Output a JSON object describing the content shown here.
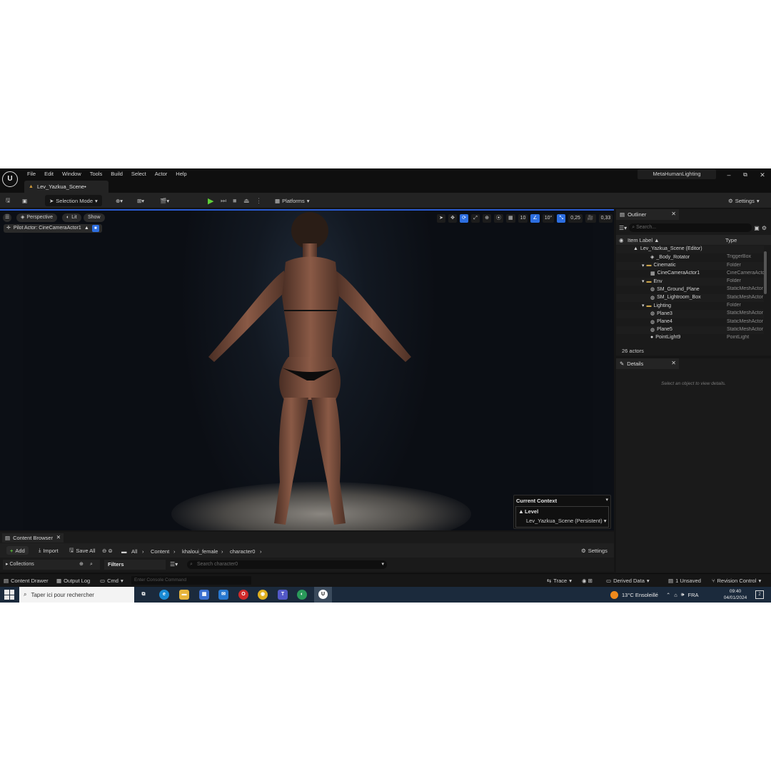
{
  "window": {
    "logo": "U",
    "menus": [
      "File",
      "Edit",
      "Window",
      "Tools",
      "Build",
      "Select",
      "Actor",
      "Help"
    ],
    "tab_title": "Lev_Yazkua_Scene•",
    "project_name": "MetaHumanLighting",
    "controls": [
      "–",
      "⧉",
      "✕"
    ]
  },
  "toolbar": {
    "selection_mode": "Selection Mode",
    "platforms": "Platforms",
    "settings": "Settings"
  },
  "viewport": {
    "perspective": "Perspective",
    "lit": "Lit",
    "show": "Show",
    "pilot_actor": "Pilot Actor: CineCameraActor1",
    "grid_size": "10",
    "rotation_snap": "10°",
    "scale_snap": "0,25",
    "camera_speed": "0,33"
  },
  "context": {
    "title": "Current Context",
    "level_label": "Level",
    "level_value": "Lev_Yazkua_Scene (Persistent)"
  },
  "outliner": {
    "tab": "Outliner",
    "search_placeholder": "Search...",
    "col_label": "Item Label ▲",
    "col_type": "Type",
    "rows": [
      {
        "label": "Lev_Yazkua_Scene (Editor)",
        "type": "",
        "indent": 0,
        "icon": "level"
      },
      {
        "label": "_Body_Rotator",
        "type": "TriggerBox",
        "indent": 2,
        "icon": "actor"
      },
      {
        "label": "Cinematic",
        "type": "Folder",
        "indent": 1,
        "icon": "folder"
      },
      {
        "label": "CineCameraActor1",
        "type": "CineCameraActor",
        "indent": 2,
        "icon": "camera"
      },
      {
        "label": "Env",
        "type": "Folder",
        "indent": 1,
        "icon": "folder"
      },
      {
        "label": "SM_Ground_Plane",
        "type": "StaticMeshActor",
        "indent": 2,
        "icon": "mesh"
      },
      {
        "label": "SM_Lightroom_Box",
        "type": "StaticMeshActor",
        "indent": 2,
        "icon": "mesh"
      },
      {
        "label": "Lighting",
        "type": "Folder",
        "indent": 1,
        "icon": "folder"
      },
      {
        "label": "Plane3",
        "type": "StaticMeshActor",
        "indent": 2,
        "icon": "mesh"
      },
      {
        "label": "Plane4",
        "type": "StaticMeshActor",
        "indent": 2,
        "icon": "mesh"
      },
      {
        "label": "Plane5",
        "type": "StaticMeshActor",
        "indent": 2,
        "icon": "mesh"
      },
      {
        "label": "PointLight9",
        "type": "PointLight",
        "indent": 2,
        "icon": "light"
      }
    ],
    "count": "26 actors"
  },
  "details": {
    "tab": "Details",
    "empty": "Select an object to view details."
  },
  "content_browser": {
    "tab": "Content Browser",
    "add": "Add",
    "import": "Import",
    "save_all": "Save All",
    "breadcrumbs": [
      "All",
      "Content",
      "khaloui_female",
      "character0"
    ],
    "settings": "Settings",
    "collections": "Collections",
    "filters": "Filters",
    "search_placeholder": "Search character0"
  },
  "statusbar": {
    "content_drawer": "Content Drawer",
    "output_log": "Output Log",
    "cmd": "Cmd",
    "console_placeholder": "Enter Console Command",
    "trace": "Trace",
    "derived_data": "Derived Data",
    "unsaved": "1 Unsaved",
    "revision_control": "Revision Control"
  },
  "taskbar": {
    "search": "Taper ici pour rechercher",
    "weather": "13°C  Ensoleillé",
    "lang": "FRA",
    "time": "09:40",
    "date": "04/01/2024",
    "notifications": "2"
  },
  "colors": {
    "accent": "#2d6ee0",
    "play": "#5fcf3a",
    "folder": "#c9a24a"
  }
}
